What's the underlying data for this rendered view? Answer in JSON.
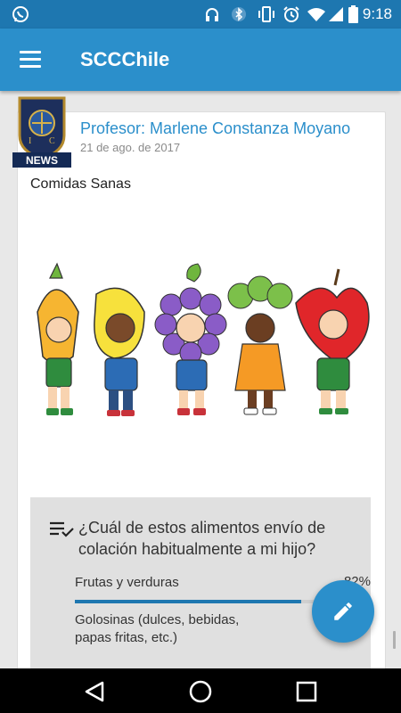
{
  "status_bar": {
    "time": "9:18",
    "icons": [
      "whatsapp-icon",
      "headphones-icon",
      "bluetooth-icon",
      "vibrate-icon",
      "alarm-icon",
      "wifi-icon",
      "signal-icon",
      "battery-icon"
    ]
  },
  "app_bar": {
    "title": "SCCChile",
    "menu_icon": "hamburger-menu-icon"
  },
  "post": {
    "avatar_badge": "NEWS",
    "author": "Profesor: Marlene Constanza Moyano",
    "date": "21 de ago. de 2017",
    "title": "Comidas Sanas",
    "image_icon": "healthy-food-kids-illustration"
  },
  "poll": {
    "icon": "poll-checklist-icon",
    "question": "¿Cuál de estos alimentos envío de colación habitualmente a mi hijo?",
    "options": [
      {
        "label": "Frutas y verduras",
        "percent_text": "82%",
        "fraction": 0.82
      },
      {
        "label": "Golosinas (dulces, bebidas, papas fritas, etc.)",
        "percent_text": "",
        "fraction": 0.0
      }
    ]
  },
  "fab": {
    "icon": "edit-pencil-icon"
  },
  "nav_bar": {
    "icons": [
      "back-triangle-icon",
      "home-circle-icon",
      "recents-square-icon"
    ]
  },
  "colors": {
    "primary": "#2b8fcb",
    "status_bar": "#1e77b0",
    "poll_bg": "#e0e0e0",
    "bar_fill": "#1e77b0"
  }
}
